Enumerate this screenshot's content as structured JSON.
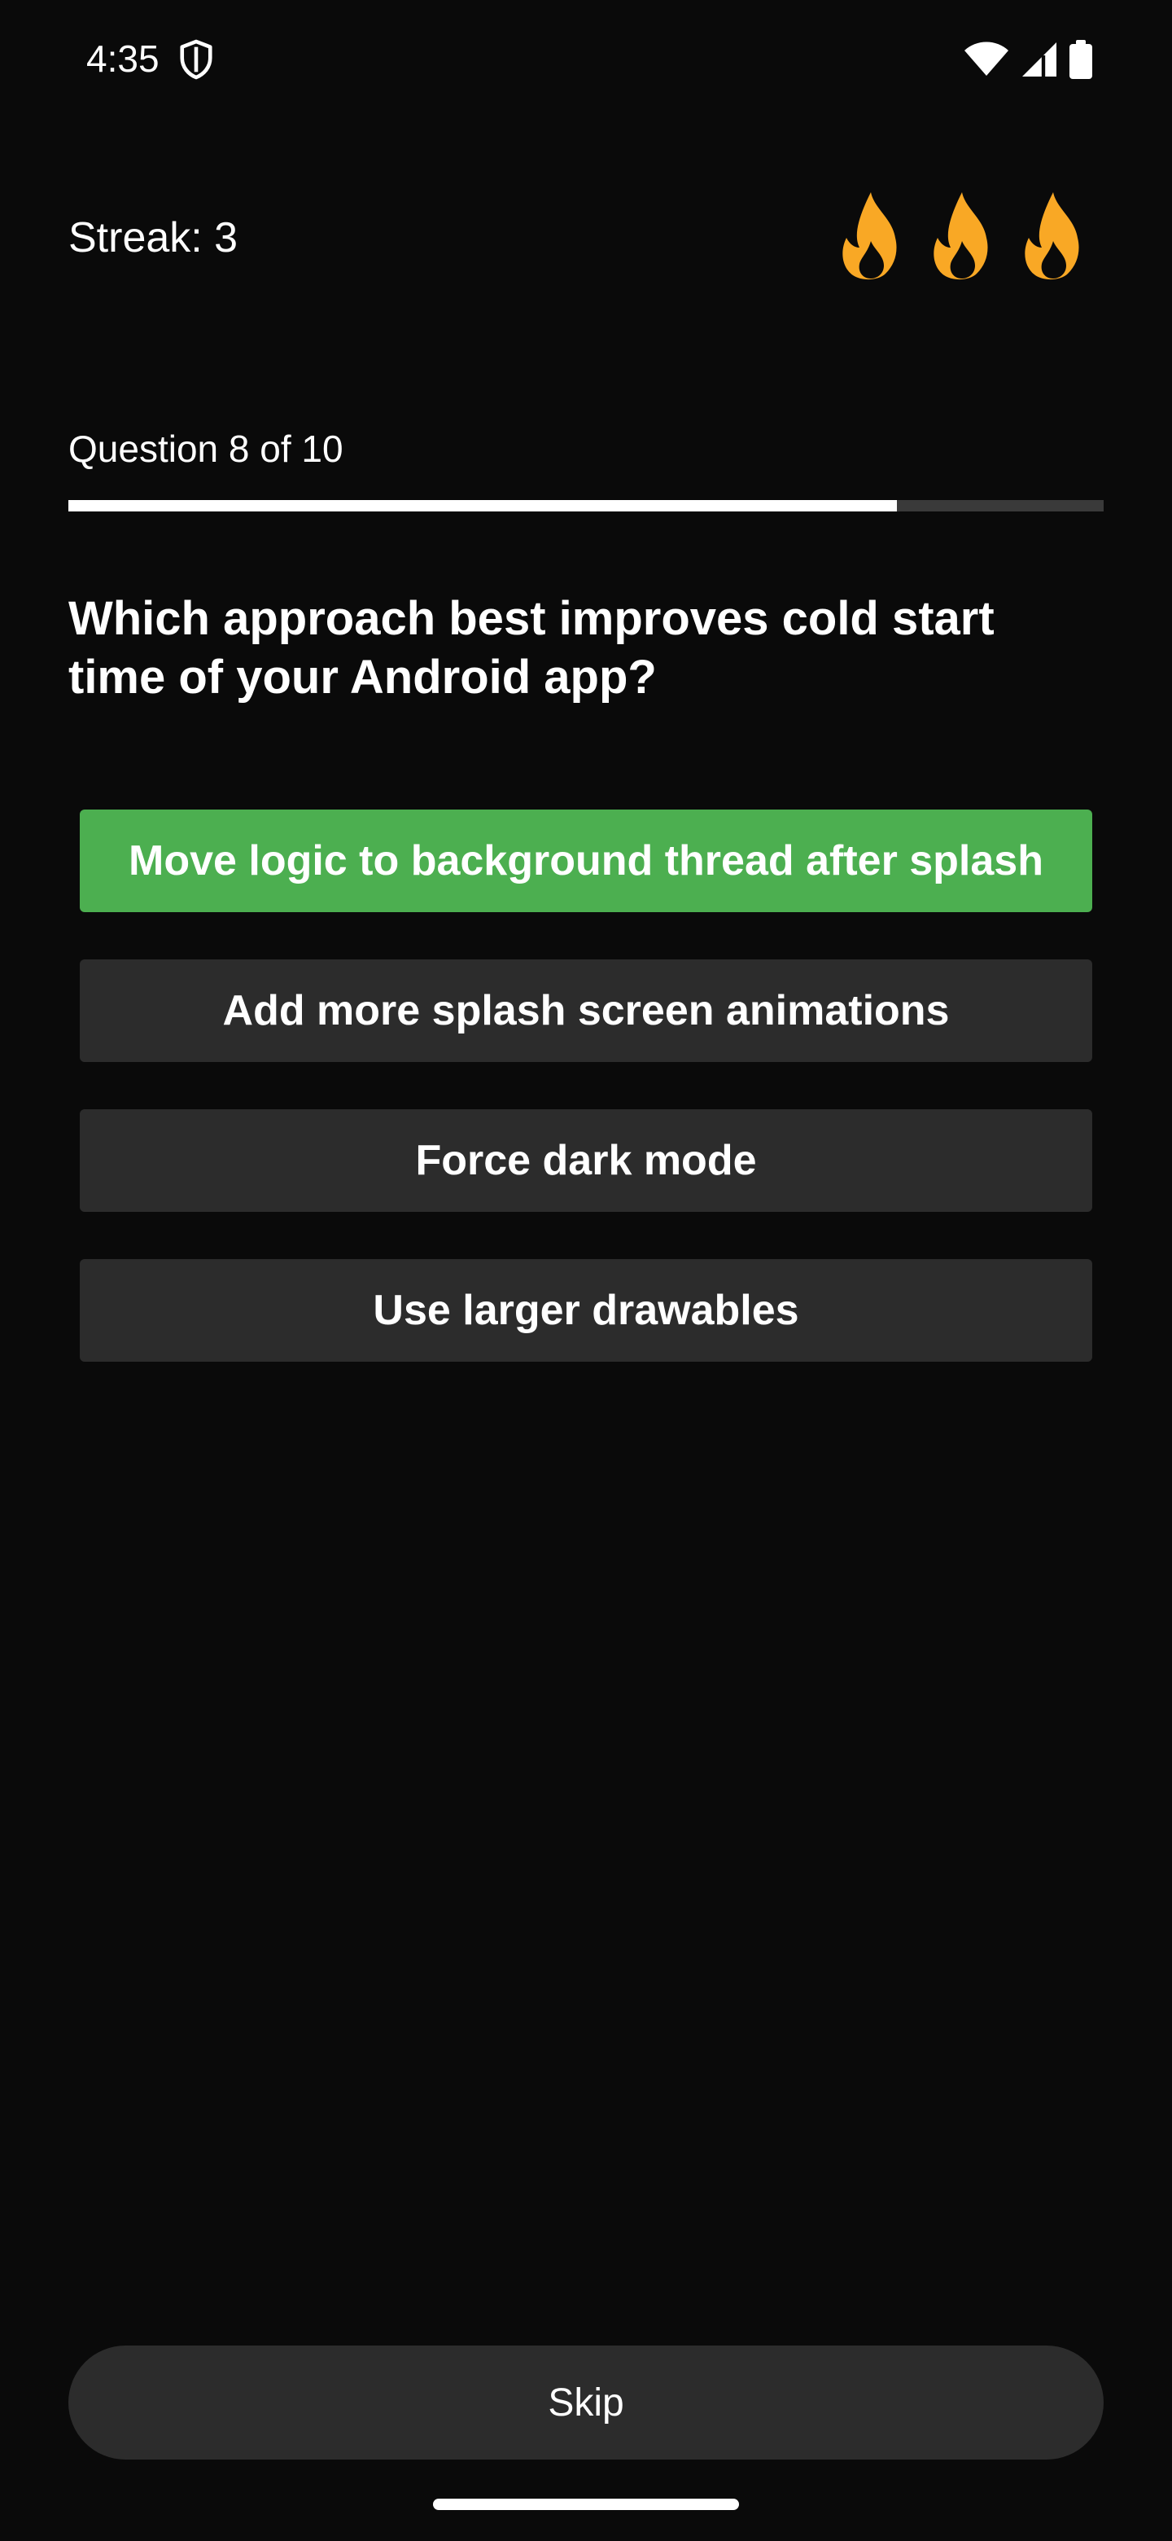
{
  "status_bar": {
    "time": "4:35",
    "shield_icon": "shield-icon",
    "wifi_icon": "wifi-icon",
    "signal_icon": "cellular-signal-icon",
    "battery_icon": "battery-icon"
  },
  "streak": {
    "label": "Streak: 3",
    "flame_icon": "flame-icon",
    "flame_color": "#f9a825",
    "count": 3
  },
  "progress": {
    "label": "Question 8 of 10",
    "fraction": 0.8
  },
  "question": {
    "text": "Which approach best improves cold start time of your Android app?"
  },
  "answers": [
    {
      "label": "Move logic to background thread after splash",
      "state": "correct"
    },
    {
      "label": "Add more splash screen animations",
      "state": "default"
    },
    {
      "label": "Force dark mode",
      "state": "default"
    },
    {
      "label": "Use larger drawables",
      "state": "default"
    }
  ],
  "skip": {
    "label": "Skip"
  },
  "colors": {
    "background": "#0a0a0a",
    "correct": "#4caf50",
    "button": "#2c2c2c",
    "progress_track": "#3a3a3a",
    "progress_fill": "#ffffff"
  }
}
